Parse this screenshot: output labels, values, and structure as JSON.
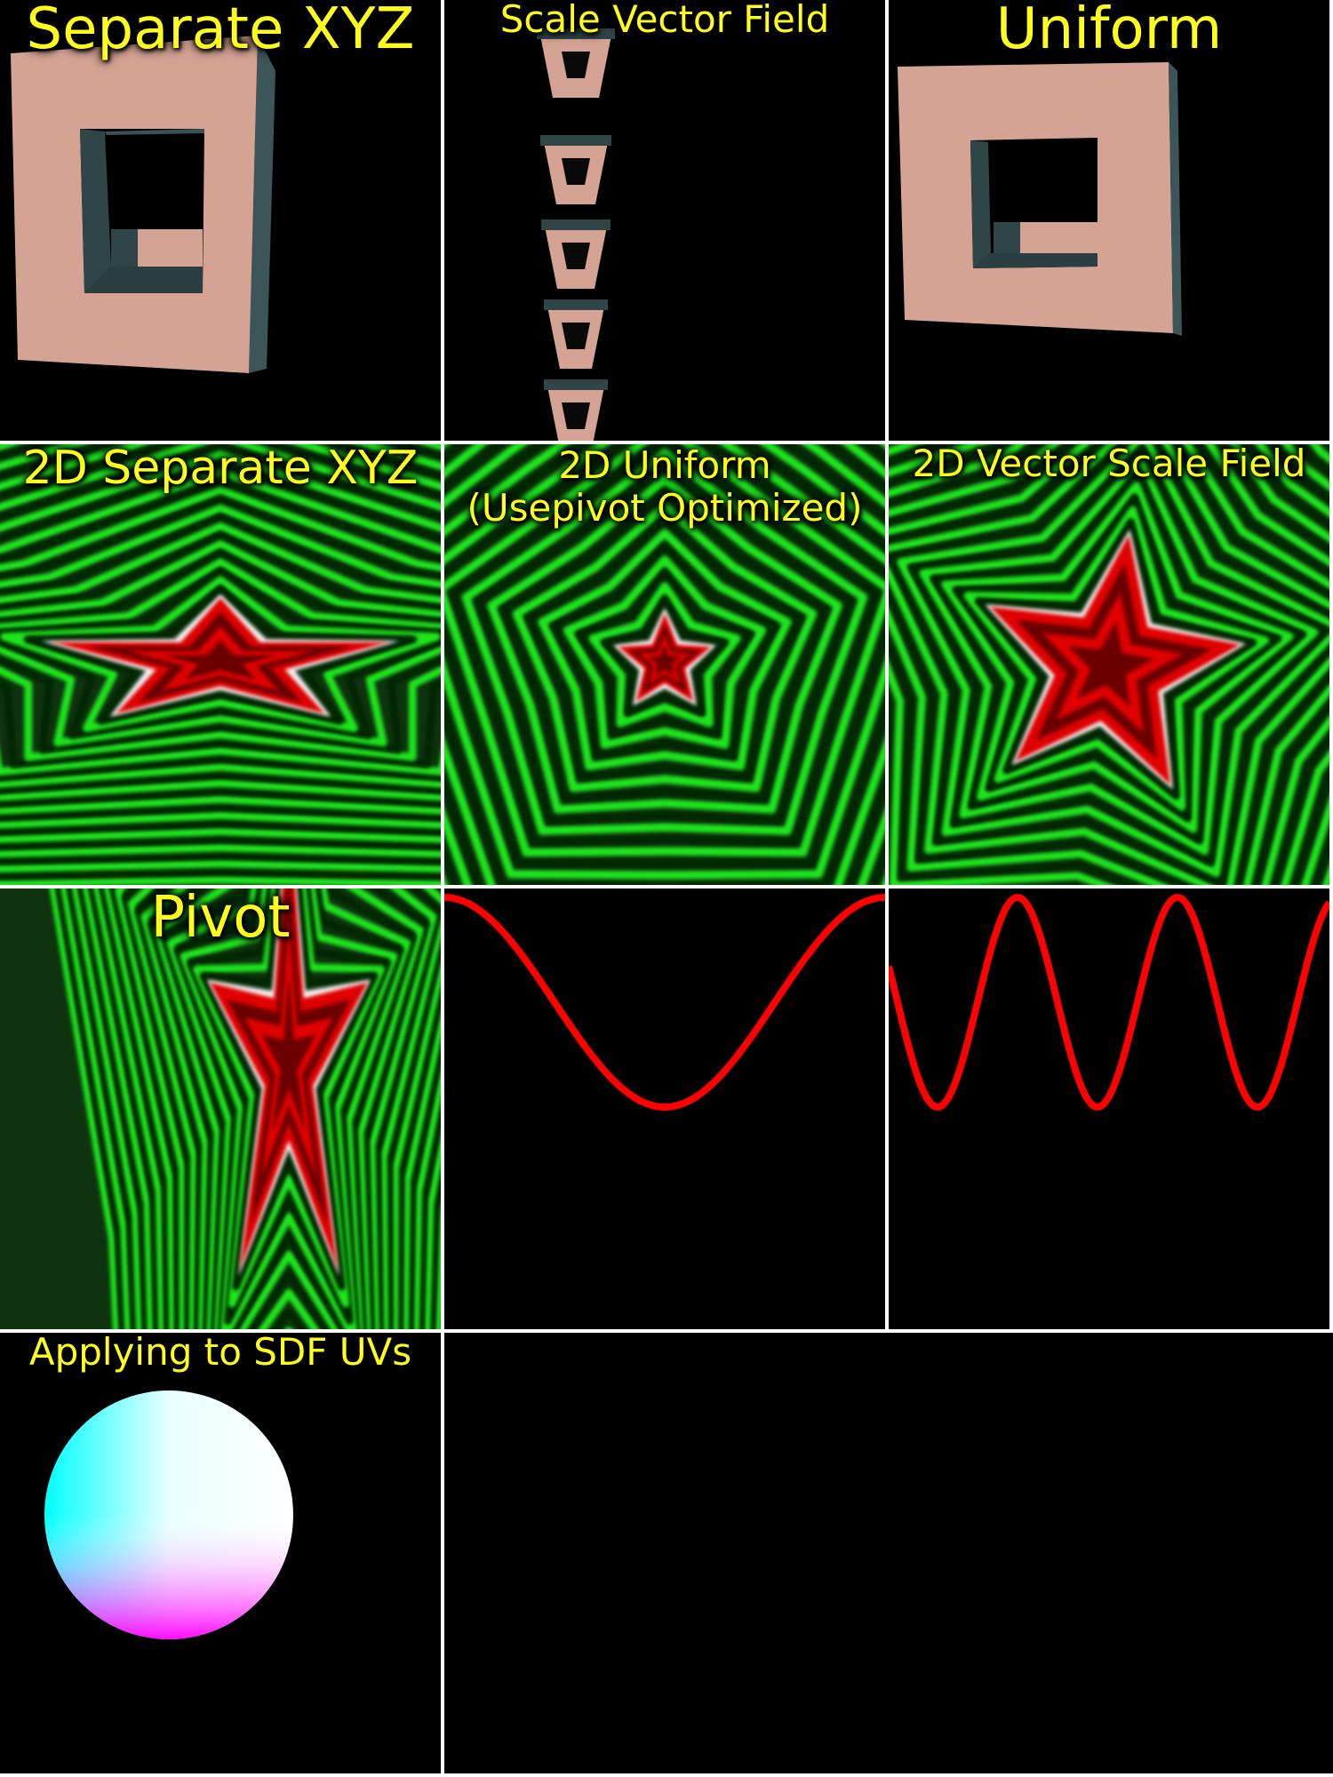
{
  "panels": [
    {
      "id": "separate-xyz",
      "label": "Separate XYZ"
    },
    {
      "id": "scale-vector-field",
      "label": "Scale Vector Field"
    },
    {
      "id": "uniform",
      "label": "Uniform"
    },
    {
      "id": "2d-separate-xyz",
      "label": "2D Separate XYZ"
    },
    {
      "id": "2d-uniform",
      "label_line1": "2D Uniform",
      "label_line2": "(Usepivot Optimized)"
    },
    {
      "id": "2d-vector-scale-field",
      "label": "2D Vector Scale Field"
    },
    {
      "id": "pivot",
      "label": "Pivot"
    },
    {
      "id": "wave-single",
      "label": ""
    },
    {
      "id": "wave-multi",
      "label": ""
    },
    {
      "id": "sdf-uvs",
      "label": "Applying to SDF UVs"
    }
  ],
  "colors": {
    "label": "#ffff1a",
    "box": "#d7a596",
    "box_inner": "#2f4548",
    "ring_green": "#19e619",
    "star_red": "#e60000",
    "wave": "#ff0000",
    "divider": "#ffffff"
  }
}
